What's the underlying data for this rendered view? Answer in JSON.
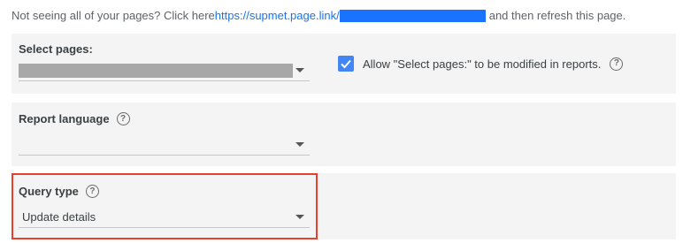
{
  "notice": {
    "prefix": "Not seeing all of your pages? Click here ",
    "link": "https://supmet.page.link/",
    "suffix": " and then refresh this page."
  },
  "select_pages": {
    "label": "Select pages:",
    "checkbox_label": "Allow \"Select pages:\" to be modified in reports.",
    "checkbox_checked": true
  },
  "report_language": {
    "label": "Report language",
    "value": ""
  },
  "query_type": {
    "label": "Query type",
    "value": "Update details"
  },
  "icons": {
    "help": "help-circle-icon",
    "dropdown": "caret-down-icon",
    "check": "check-icon"
  },
  "colors": {
    "link": "#1a73e8",
    "checkbox": "#4285f4",
    "highlight": "#e8402f",
    "panel": "#f4f4f4"
  }
}
